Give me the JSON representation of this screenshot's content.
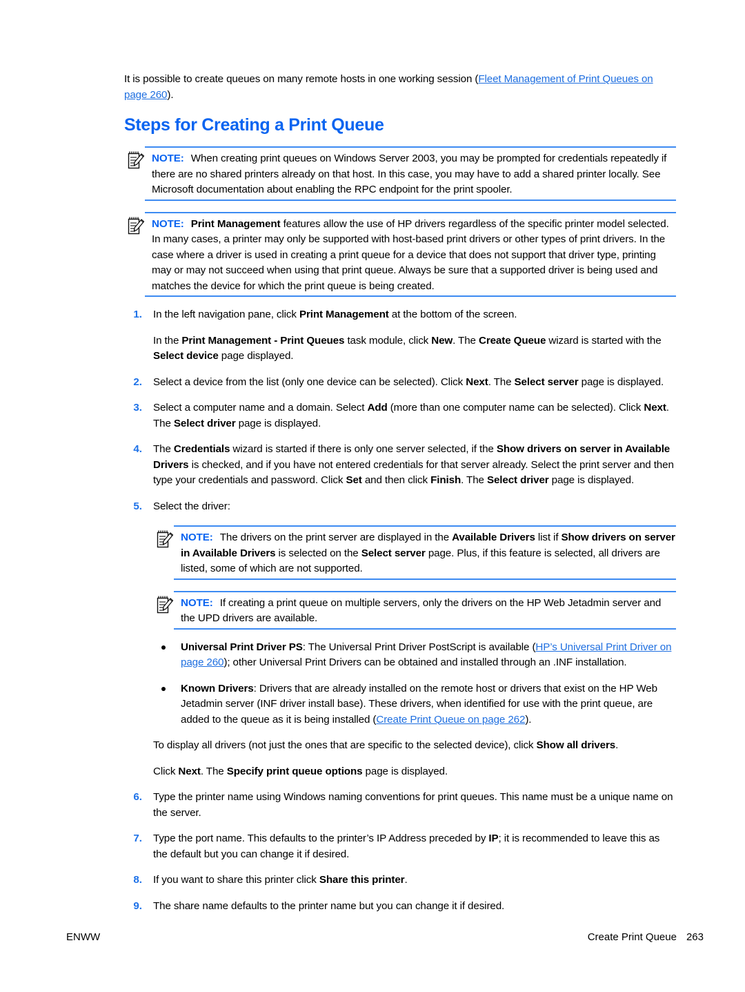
{
  "document": {
    "intro": {
      "text_before": "It is possible to create queues on many remote hosts in one working session (",
      "link": "Fleet Management of Print Queues on page 260",
      "text_after": ")."
    },
    "section_title": "Steps for Creating a Print Queue",
    "note_label": "NOTE:",
    "note_icon": "note-pencil-icon",
    "notes": {
      "note1": "When creating print queues on Windows Server 2003, you may be prompted for credentials repeatedly if there are no shared printers already on that host. In this case, you may have to add a shared printer locally. See Microsoft documentation about enabling the RPC endpoint for the print spooler.",
      "note2_bold": "Print Management",
      "note2_rest": " features allow the use of HP drivers regardless of the specific printer model selected. In many cases, a printer may only be supported with host-based print drivers or other types of print drivers. In the case where a driver is used in creating a print queue for a device that does not support that driver type, printing may or may not succeed when using that print queue. Always be sure that a supported driver is being used and matches the device for which the print queue is being created.",
      "note3_p1": "The drivers on the print server are displayed in the ",
      "note3_b1": "Available Drivers",
      "note3_p2": " list if ",
      "note3_b2": "Show drivers on server in Available Drivers",
      "note3_p3": " is selected on the ",
      "note3_b3": "Select server",
      "note3_p4": " page. Plus, if this feature is selected, all drivers are listed, some of which are not supported.",
      "note4": "If creating a print queue on multiple servers, only the drivers on the HP Web Jetadmin server and the UPD drivers are available."
    },
    "steps": {
      "s1_num": "1.",
      "s1_p1": "In the left navigation pane, click ",
      "s1_b1": "Print Management",
      "s1_p2": " at the bottom of the screen.",
      "s1_sub_p1": "In the ",
      "s1_sub_b1": "Print Management - Print Queues",
      "s1_sub_p2": " task module, click ",
      "s1_sub_b2": "New",
      "s1_sub_p3": ". The ",
      "s1_sub_b3": "Create Queue",
      "s1_sub_p4": " wizard is started with the ",
      "s1_sub_b4": "Select device",
      "s1_sub_p5": " page displayed.",
      "s2_num": "2.",
      "s2_p1": "Select a device from the list (only one device can be selected). Click ",
      "s2_b1": "Next",
      "s2_p2": ". The ",
      "s2_b2": "Select server",
      "s2_p3": " page is displayed.",
      "s3_num": "3.",
      "s3_p1": "Select a computer name and a domain. Select ",
      "s3_b1": "Add",
      "s3_p2": " (more than one computer name can be selected). Click ",
      "s3_b2": "Next",
      "s3_p3": ". The ",
      "s3_b3": "Select driver",
      "s3_p4": " page is displayed.",
      "s4_num": "4.",
      "s4_p1": "The ",
      "s4_b1": "Credentials",
      "s4_p2": " wizard is started if there is only one server selected, if the ",
      "s4_b2": "Show drivers on server in Available Drivers",
      "s4_p3": " is checked, and if you have not entered credentials for that server already. Select the print server and then type your credentials and password. Click ",
      "s4_b3": "Set",
      "s4_p4": " and then click ",
      "s4_b4": "Finish",
      "s4_p5": ". The ",
      "s4_b5": "Select driver",
      "s4_p6": " page is displayed.",
      "s5_num": "5.",
      "s5_p1": "Select the driver:",
      "s6_num": "6.",
      "s6_p1": "Type the printer name using Windows naming conventions for print queues. This name must be a unique name on the server.",
      "s7_num": "7.",
      "s7_p1": "Type the port name. This defaults to the printer’s IP Address preceded by ",
      "s7_b1": "IP",
      "s7_p2": "; it is recommended to leave this as the default but you can change it if desired.",
      "s8_num": "8.",
      "s8_p1": "If you want to share this printer click ",
      "s8_b1": "Share this printer",
      "s8_p2": ".",
      "s9_num": "9.",
      "s9_p1": "The share name defaults to the printer name but you can change it if desired."
    },
    "bullets": {
      "b1_bold": "Universal Print Driver PS",
      "b1_p1": ": The Universal Print Driver PostScript is available (",
      "b1_link": "HP’s Universal Print Driver on page 260",
      "b1_p2": "); other Universal Print Drivers can be obtained and installed through an .INF installation.",
      "b2_bold": "Known Drivers",
      "b2_p1": ": Drivers that are already installed on the remote host or drivers that exist on the HP Web Jetadmin server (INF driver install base). These drivers, when identified for use with the print queue, are added to the queue as it is being installed (",
      "b2_link": "Create Print Queue on page 262",
      "b2_p2": ")."
    },
    "trailing": {
      "show_all_p1": "To display all drivers (not just the ones that are specific to the selected device), click ",
      "show_all_b1": "Show all drivers",
      "show_all_p2": ".",
      "click_next_p1": "Click ",
      "click_next_b1": "Next",
      "click_next_p2": ". The ",
      "click_next_b2": "Specify print queue options",
      "click_next_p3": " page is displayed."
    },
    "footer": {
      "left": "ENWW",
      "chapter": "Create Print Queue",
      "page_number": "263"
    },
    "colors": {
      "heading_blue": "#0a64f0",
      "link_blue": "#1f6fe0",
      "rule_blue": "#3d8bf2",
      "list_number_blue": "#1e72e8"
    }
  }
}
